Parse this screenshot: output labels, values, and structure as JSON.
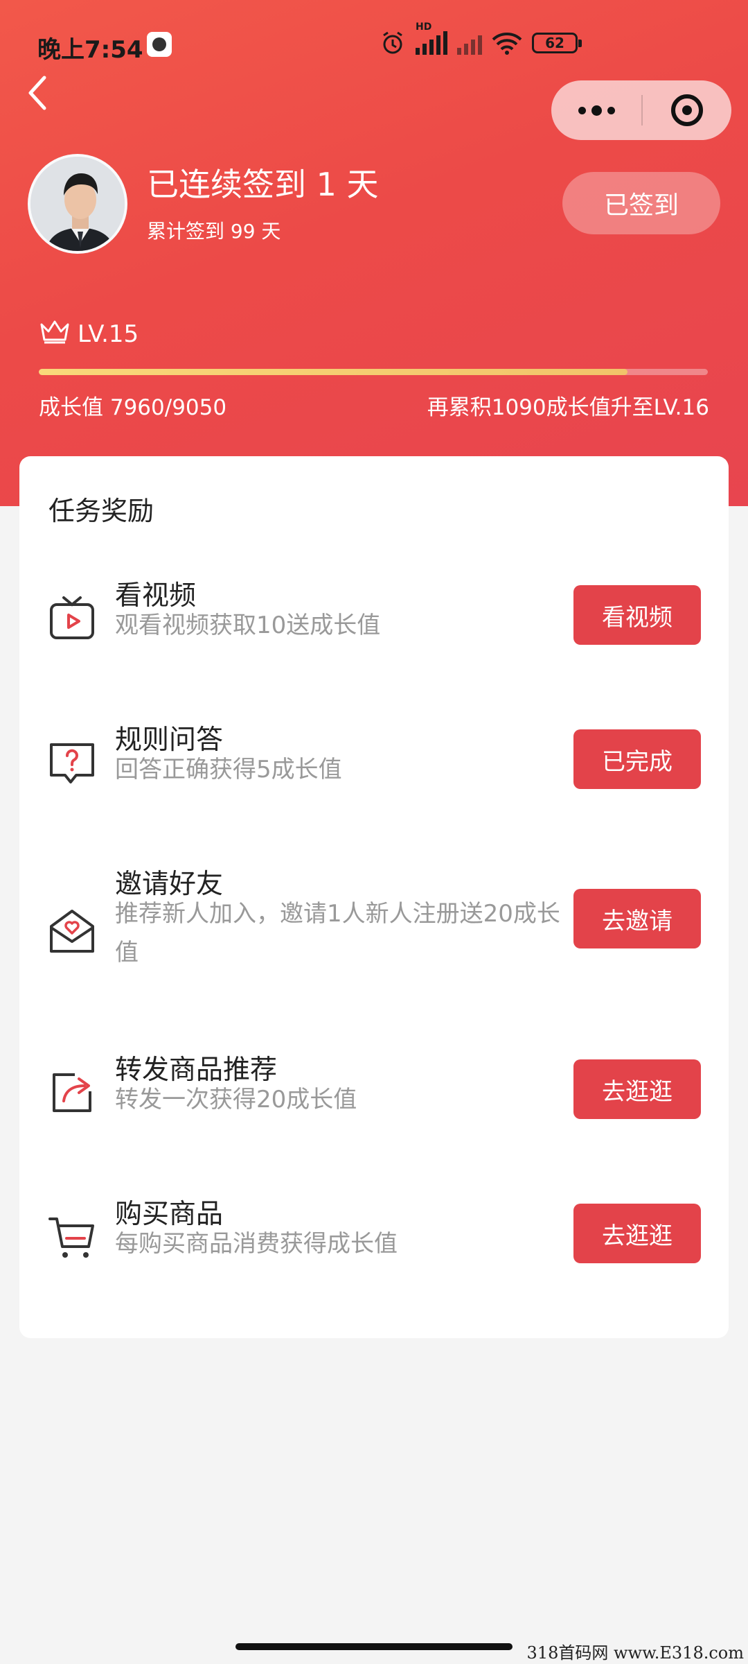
{
  "status_bar": {
    "time": "晚上7:54",
    "hd": "HD",
    "battery": "62"
  },
  "profile": {
    "streak": "已连续签到 1 天",
    "total": "累计签到 99 天",
    "sign_button": "已签到"
  },
  "level": {
    "label": "LV.15",
    "growth": "成长值 7960/9050",
    "progress": 0.88,
    "next": "再累积1090成长值升至LV.16"
  },
  "tasks_title": "任务奖励",
  "tasks": [
    {
      "icon": "tv-play-icon",
      "name": "看视频",
      "desc": "观看视频获取10送成长值",
      "button": "看视频"
    },
    {
      "icon": "question-bubble-icon",
      "name": "规则问答",
      "desc": "回答正确获得5成长值",
      "button": "已完成"
    },
    {
      "icon": "envelope-heart-icon",
      "name": "邀请好友",
      "desc": "推荐新人加入，邀请1人新人注册送20成长值",
      "button": "去邀请"
    },
    {
      "icon": "share-forward-icon",
      "name": "转发商品推荐",
      "desc": "转发一次获得20成长值",
      "button": "去逛逛"
    },
    {
      "icon": "shopping-cart-icon",
      "name": "购买商品",
      "desc": "每购买商品消费获得成长值",
      "button": "去逛逛"
    }
  ],
  "colors": {
    "hero": "#ec4a48",
    "button": "#e3434a",
    "progress": "#f1c36a"
  },
  "watermark": "318首码网 www.E318.com"
}
